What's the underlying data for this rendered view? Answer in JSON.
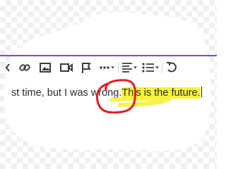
{
  "toolbar": {
    "items": [
      {
        "icon": "chevron-left-icon"
      },
      {
        "icon": "link-icon"
      },
      {
        "icon": "image-icon"
      },
      {
        "icon": "video-icon"
      },
      {
        "icon": "flag-icon"
      },
      {
        "icon": "more-icon"
      },
      {
        "icon": "align-left-icon"
      },
      {
        "icon": "bulleted-list-icon"
      },
      {
        "icon": "undo-icon"
      }
    ]
  },
  "editor": {
    "text_before": "st time, but I was wrong.",
    "text_highlighted_1": "This is",
    "text_highlighted_2": " the future."
  },
  "colors": {
    "accent": "#7c4dbd",
    "highlight": "#f6f23a",
    "annotation_circle": "#e31b23"
  }
}
